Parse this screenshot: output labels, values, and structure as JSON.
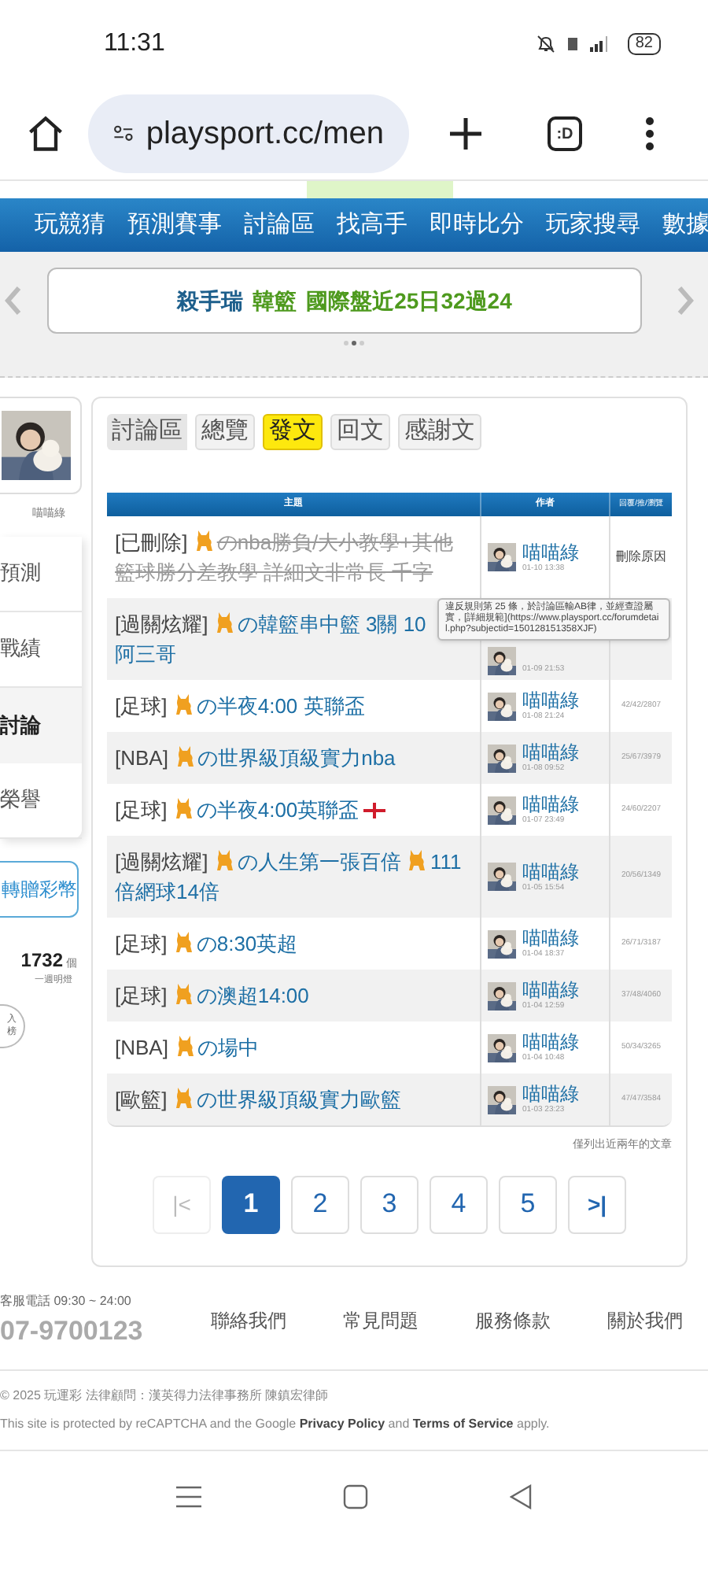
{
  "status_bar": {
    "time": "11:31",
    "battery": "82"
  },
  "browser": {
    "url": "playsport.cc/men",
    "tab_label": ":D"
  },
  "nav": {
    "items": [
      "玩競猜",
      "預測賽事",
      "討論區",
      "找高手",
      "即時比分",
      "玩家搜尋",
      "數據"
    ]
  },
  "banner": {
    "parts": [
      {
        "text": "殺手瑞",
        "color": "#1d5f8c"
      },
      {
        "text": "韓籃",
        "color": "#4e9a1e"
      },
      {
        "text": "國際盤近25日32過24",
        "color": "#4e9a1e"
      }
    ]
  },
  "sidebar": {
    "username": "喵喵綠",
    "items": [
      {
        "label": "預測",
        "selected": false
      },
      {
        "label": "戰績",
        "selected": false
      },
      {
        "label": "討論",
        "selected": true
      },
      {
        "label": "榮譽",
        "selected": false
      }
    ],
    "gift_button": "轉贈彩幣",
    "count": "1732",
    "count_unit": "個",
    "count_caption": "一週明燈",
    "badge": [
      "入",
      "榜"
    ]
  },
  "tabs": [
    {
      "label": "討論區",
      "kind": "crumb",
      "selected": false
    },
    {
      "label": "總覽",
      "kind": "tab",
      "selected": false
    },
    {
      "label": "發文",
      "kind": "tab",
      "selected": true
    },
    {
      "label": "回文",
      "kind": "tab",
      "selected": false
    },
    {
      "label": "感謝文",
      "kind": "tab",
      "selected": false
    }
  ],
  "table": {
    "columns": [
      "主題",
      "作者",
      "回覆/推/瀏覽"
    ],
    "rows": [
      {
        "kind": "deleted",
        "prefix": "[已刪除]",
        "title": [
          "のnba勝負/大小教學+其他籃球勝分差教學 詳細文非常長 千字"
        ],
        "author": "喵喵綠",
        "date": "01-10 13:38",
        "stats": "刪除原因"
      },
      {
        "kind": "normal",
        "prefix": "[過關炫耀]",
        "title": [
          "の韓籃串中籃 3關 10"
        ],
        "continuation": "阿三哥",
        "date": "01-09 21:53"
      },
      {
        "kind": "normal",
        "prefix": "[足球]",
        "title": [
          "の半夜4:00 英聯盃"
        ],
        "author": "喵喵綠",
        "date": "01-08 21:24",
        "stats": "42/42/2807"
      },
      {
        "kind": "normal",
        "prefix": "[NBA]",
        "title": [
          "の世界級頂級實力nba"
        ],
        "author": "喵喵綠",
        "date": "01-08 09:52",
        "stats": "25/67/3979"
      },
      {
        "kind": "normal",
        "prefix": "[足球]",
        "title": [
          "の半夜4:00英聯盃"
        ],
        "flag": true,
        "author": "喵喵綠",
        "date": "01-07 23:49",
        "stats": "24/60/2207"
      },
      {
        "kind": "normal",
        "prefix": "[過關炫耀]",
        "title": [
          "の人生第一張百倍",
          "111倍網球14倍"
        ],
        "author": "喵喵綠",
        "date": "01-05 15:54",
        "stats": "20/56/1349"
      },
      {
        "kind": "normal",
        "prefix": "[足球]",
        "title": [
          "の8:30英超"
        ],
        "author": "喵喵綠",
        "date": "01-04 18:37",
        "stats": "26/71/3187"
      },
      {
        "kind": "normal",
        "prefix": "[足球]",
        "title": [
          "の澳超14:00"
        ],
        "author": "喵喵綠",
        "date": "01-04 12:59",
        "stats": "37/48/4060"
      },
      {
        "kind": "normal",
        "prefix": "[NBA]",
        "title": [
          "の場中"
        ],
        "author": "喵喵綠",
        "date": "01-04 10:48",
        "stats": "50/34/3265"
      },
      {
        "kind": "normal",
        "prefix": "[歐籃]",
        "title": [
          "の世界級頂級實力歐籃"
        ],
        "author": "喵喵綠",
        "date": "01-03 23:23",
        "stats": "47/47/3584"
      }
    ],
    "note": "僅列出近兩年的文章"
  },
  "tooltip": "違反規則第 25 條，於討論區輸AB律，並經查證屬實，[詳細規範](https://www.playsport.cc/forumdetail.php?subjectid=150128151358XJF)",
  "pagination": {
    "first": "|<",
    "last": ">|",
    "pages": [
      {
        "label": "1",
        "selected": true
      },
      {
        "label": "2",
        "selected": false
      },
      {
        "label": "3",
        "selected": false
      },
      {
        "label": "4",
        "selected": false
      },
      {
        "label": "5",
        "selected": false
      }
    ]
  },
  "footer": {
    "hotline": "客服電話 09:30 ~ 24:00",
    "phone": "07-9700123",
    "links": [
      "聯絡我們",
      "常見問題",
      "服務條款",
      "關於我們"
    ],
    "copyright": "© 2025 玩運彩 法律顧問：漢英得力法律事務所 陳鎮宏律師",
    "recaptcha": "This site is protected by reCAPTCHA and the Google **Privacy Policy** and **Terms of Service** apply."
  }
}
